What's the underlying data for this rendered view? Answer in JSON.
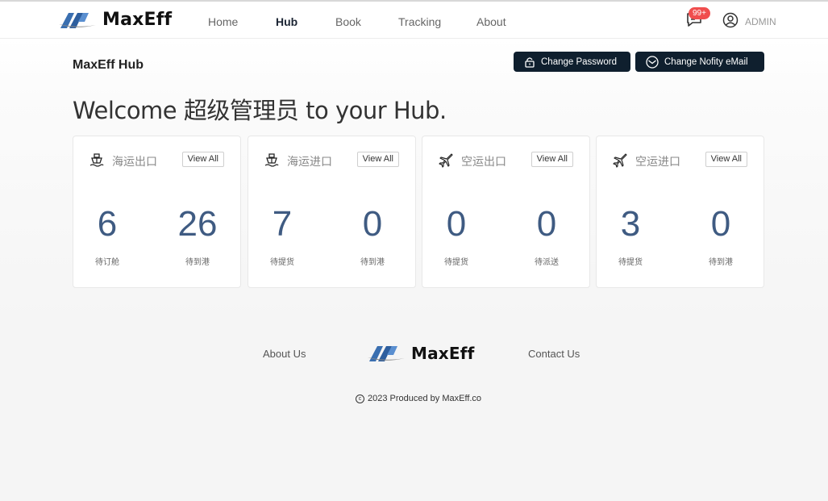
{
  "header": {
    "logo_text": "MaxEff",
    "nav": [
      {
        "label": "Home",
        "active": false
      },
      {
        "label": "Hub",
        "active": true
      },
      {
        "label": "Book",
        "active": false
      },
      {
        "label": "Tracking",
        "active": false
      },
      {
        "label": "About",
        "active": false
      }
    ],
    "notification_badge": "99+",
    "user_label": "ADMIN",
    "icons": {
      "messages": "chat-bubble-icon",
      "user": "user-circle-icon"
    }
  },
  "hub": {
    "title": "MaxEff Hub",
    "buttons": {
      "change_password": "Change Password",
      "change_email": "Change Nofity eMail"
    },
    "welcome_prefix": "Welcome ",
    "welcome_name": "超级管理员",
    "welcome_suffix": " to your Hub."
  },
  "cards": [
    {
      "title": "海运出口",
      "icon": "ship-icon",
      "view_all": "View All",
      "left": {
        "value": "6",
        "label": "待订舱"
      },
      "right": {
        "value": "26",
        "label": "待到港"
      }
    },
    {
      "title": "海运进口",
      "icon": "ship-icon",
      "view_all": "View All",
      "left": {
        "value": "7",
        "label": "待提货"
      },
      "right": {
        "value": "0",
        "label": "待到港"
      }
    },
    {
      "title": "空运出口",
      "icon": "plane-icon",
      "view_all": "View All",
      "left": {
        "value": "0",
        "label": "待提货"
      },
      "right": {
        "value": "0",
        "label": "待派送"
      }
    },
    {
      "title": "空运进口",
      "icon": "plane-icon",
      "view_all": "View All",
      "left": {
        "value": "3",
        "label": "待提货"
      },
      "right": {
        "value": "0",
        "label": "待到港"
      }
    }
  ],
  "footer": {
    "about": "About Us",
    "logo_text": "MaxEff",
    "contact": "Contact Us",
    "copyright": "2023 Produced by MaxEff.co"
  },
  "colors": {
    "button_bg": "#0f1f2e",
    "number_color": "#3f5b82",
    "badge_bg": "#f04e4e"
  }
}
